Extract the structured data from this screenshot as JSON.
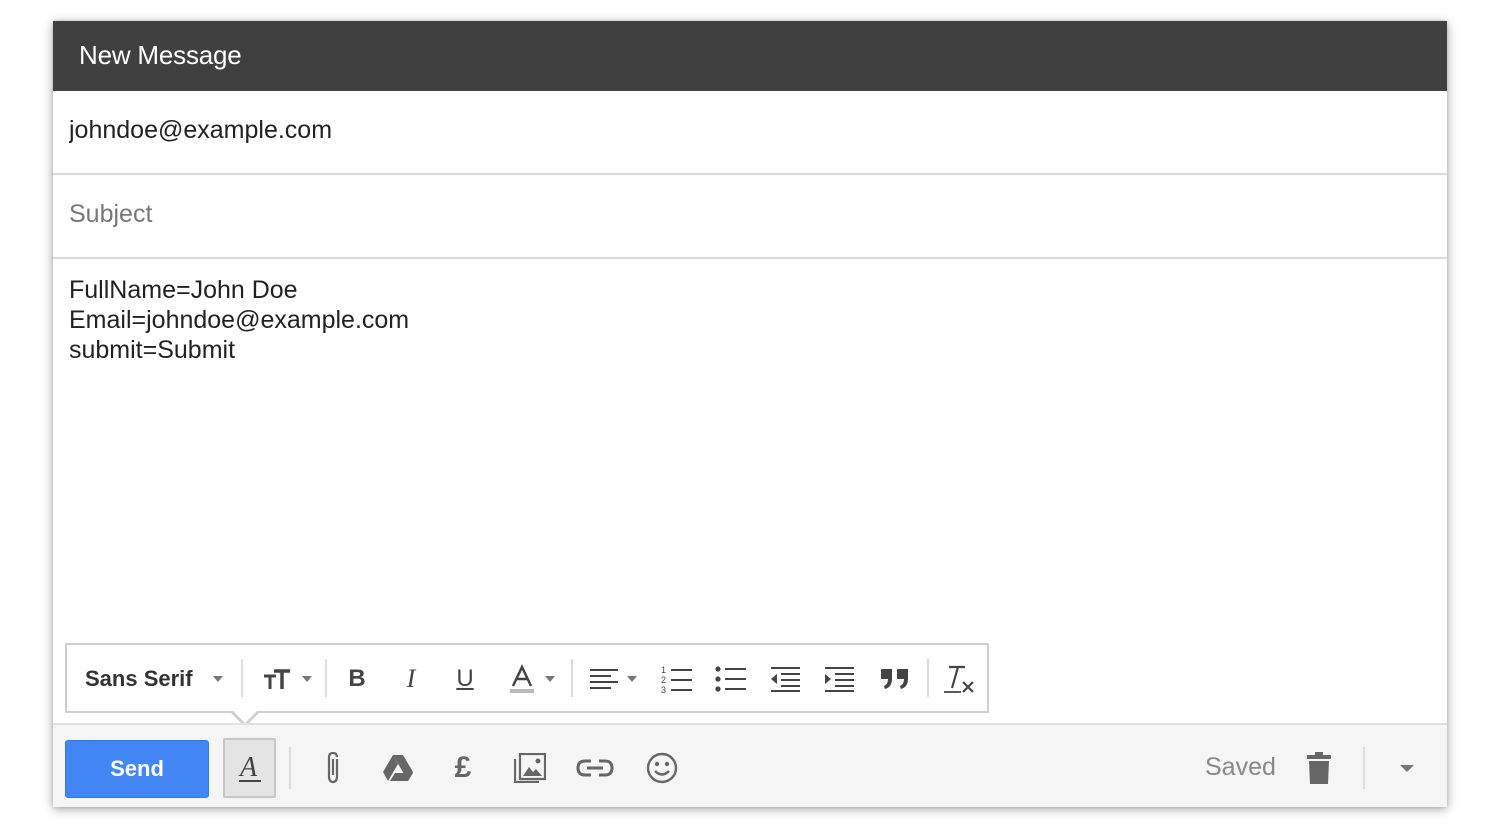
{
  "window": {
    "title": "New Message"
  },
  "compose": {
    "to_value": "johndoe@example.com",
    "subject_placeholder": "Subject",
    "body_lines": [
      "FullName=John Doe",
      "Email=johndoe@example.com",
      "submit=Submit"
    ]
  },
  "formatting_toolbar": {
    "font_name": "Sans Serif",
    "icons": [
      "font-size-icon",
      "bold-icon",
      "italic-icon",
      "underline-icon",
      "text-color-icon",
      "align-icon",
      "numbered-list-icon",
      "bulleted-list-icon",
      "indent-less-icon",
      "indent-more-icon",
      "quote-icon",
      "remove-formatting-icon"
    ]
  },
  "bottom_bar": {
    "send_label": "Send",
    "status": "Saved",
    "icons": [
      "formatting-icon",
      "attach-icon",
      "drive-icon",
      "money-icon",
      "photo-icon",
      "link-icon",
      "emoji-icon",
      "trash-icon",
      "more-options-icon"
    ]
  },
  "colors": {
    "titlebar": "#404040",
    "send_button": "#4285f4",
    "bottom_bar": "#f5f5f5"
  }
}
